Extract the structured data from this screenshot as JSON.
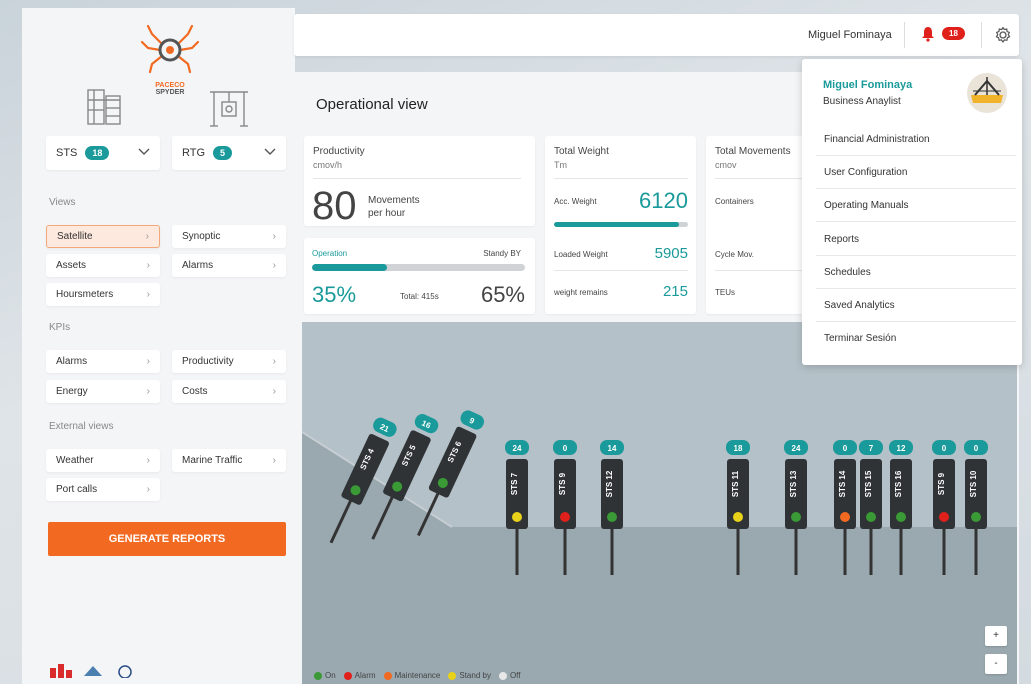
{
  "brand": {
    "name_line1": "PACECO",
    "name_line2": "SPYDER"
  },
  "selectors": [
    {
      "label": "STS",
      "count": "18"
    },
    {
      "label": "RTG",
      "count": "5"
    }
  ],
  "views": {
    "heading": "Views",
    "items": [
      "Satellite",
      "Synoptic",
      "Assets",
      "Alarms",
      "Hoursmeters"
    ]
  },
  "kpis": {
    "heading": "KPIs",
    "items": [
      "Alarms",
      "Productivity",
      "Energy",
      "Costs"
    ]
  },
  "external": {
    "heading": "External views",
    "items": [
      "Weather",
      "Marine Traffic",
      "Port calls"
    ]
  },
  "generate_label": "GENERATE REPORTS",
  "topbar": {
    "user": "Miguel Fominaya",
    "notifications": "18"
  },
  "page_title": "Operational view",
  "productivity": {
    "title": "Productivity",
    "unit": "cmov/h",
    "value": "80",
    "caption1": "Movements",
    "caption2": "per hour"
  },
  "operation": {
    "label": "Operation",
    "standby_label": "Standy BY",
    "fraction": 0.35,
    "pct_operation": "35%",
    "total": "Total: 415s",
    "pct_standby": "65%"
  },
  "weight": {
    "title": "Total Weight",
    "unit": "Tm",
    "acc_label": "Acc. Weight",
    "acc_value": "6120",
    "acc_fraction": 0.93,
    "loaded_label": "Loaded Weight",
    "loaded_value": "5905",
    "remain_label": "weight remains",
    "remain_value": "215"
  },
  "movements": {
    "title": "Total Movements",
    "unit": "cmov",
    "containers": "Containers",
    "cycle": "Cycle Mov.",
    "teus": "TEUs"
  },
  "legend": [
    {
      "label": "On",
      "color": "#3a9a35"
    },
    {
      "label": "Alarm",
      "color": "#e0201b"
    },
    {
      "label": "Maintenance",
      "color": "#f26a21"
    },
    {
      "label": "Stand by",
      "color": "#e8d21a"
    },
    {
      "label": "Off",
      "color": "#e8e8e8"
    }
  ],
  "zoom": {
    "in": "+",
    "out": "-"
  },
  "cranes": [
    {
      "name": "STS 4",
      "count": "21",
      "status": "#3a9a35"
    },
    {
      "name": "STS 5",
      "count": "16",
      "status": "#3a9a35"
    },
    {
      "name": "STS 6",
      "count": "9",
      "status": "#3a9a35"
    },
    {
      "name": "STS 7",
      "count": "24",
      "status": "#e8d21a"
    },
    {
      "name": "STS 9",
      "count": "0",
      "status": "#e0201b"
    },
    {
      "name": "STS 12",
      "count": "14",
      "status": "#3a9a35"
    },
    {
      "name": "STS 11",
      "count": "18",
      "status": "#e8d21a"
    },
    {
      "name": "STS 13",
      "count": "24",
      "status": "#3a9a35"
    },
    {
      "name": "STS 14",
      "count": "0",
      "status": "#f26a21"
    },
    {
      "name": "STS 15",
      "count": "7",
      "status": "#3a9a35"
    },
    {
      "name": "STS 16",
      "count": "12",
      "status": "#3a9a35"
    },
    {
      "name": "STS 9",
      "count": "0",
      "status": "#e0201b"
    },
    {
      "name": "STS 10",
      "count": "0",
      "status": "#3a9a35"
    }
  ],
  "user_menu": {
    "name": "Miguel Fominaya",
    "role": "Business Anaylist",
    "items": [
      "Financial Administration",
      "User Configuration",
      "Operating Manuals",
      "Reports",
      "Schedules",
      "Saved Analytics",
      "Terminar Sesión"
    ]
  },
  "colors": {
    "accent": "#f26a21",
    "teal": "#1a9a9a",
    "alert": "#e0201b"
  }
}
